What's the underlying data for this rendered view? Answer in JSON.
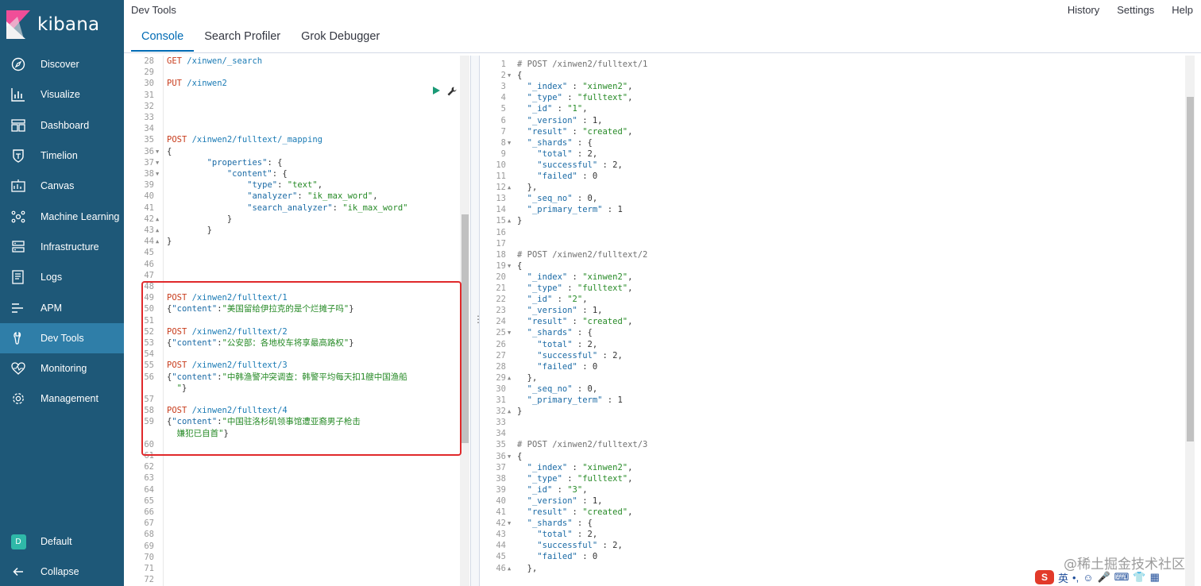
{
  "brand": {
    "name": "kibana"
  },
  "sidebar": {
    "items": [
      {
        "label": "Discover",
        "icon": "compass-icon"
      },
      {
        "label": "Visualize",
        "icon": "bar-chart-icon"
      },
      {
        "label": "Dashboard",
        "icon": "dashboard-icon"
      },
      {
        "label": "Timelion",
        "icon": "shield-icon"
      },
      {
        "label": "Canvas",
        "icon": "canvas-icon"
      },
      {
        "label": "Machine Learning",
        "icon": "machine-learning-icon"
      },
      {
        "label": "Infrastructure",
        "icon": "infrastructure-icon"
      },
      {
        "label": "Logs",
        "icon": "logs-icon"
      },
      {
        "label": "APM",
        "icon": "apm-icon"
      },
      {
        "label": "Dev Tools",
        "icon": "wrench-icon",
        "active": true
      },
      {
        "label": "Monitoring",
        "icon": "heartbeat-icon"
      },
      {
        "label": "Management",
        "icon": "gear-icon"
      }
    ],
    "space": {
      "label": "Default",
      "badge": "D"
    },
    "collapse_label": "Collapse"
  },
  "header": {
    "title": "Dev Tools",
    "links": [
      "History",
      "Settings",
      "Help"
    ],
    "tabs": [
      {
        "label": "Console",
        "active": true
      },
      {
        "label": "Search Profiler"
      },
      {
        "label": "Grok Debugger"
      }
    ]
  },
  "left_editor": {
    "lines": [
      {
        "n": "28",
        "segs": [
          [
            "m",
            "GET "
          ],
          [
            "u",
            "/xinwen/_search"
          ]
        ]
      },
      {
        "n": "29",
        "segs": []
      },
      {
        "n": "30",
        "segs": [
          [
            "m",
            "PUT "
          ],
          [
            "u",
            "/xinwen2"
          ]
        ]
      },
      {
        "n": "31",
        "segs": []
      },
      {
        "n": "32",
        "segs": []
      },
      {
        "n": "33",
        "segs": []
      },
      {
        "n": "34",
        "segs": []
      },
      {
        "n": "35",
        "segs": [
          [
            "m",
            "POST "
          ],
          [
            "u",
            "/xinwen2/fulltext/_mapping"
          ]
        ]
      },
      {
        "n": "36",
        "fold": "down",
        "segs": [
          [
            "p",
            "{"
          ]
        ]
      },
      {
        "n": "37",
        "fold": "down",
        "segs": [
          [
            "p",
            "        "
          ],
          [
            "k",
            "\"properties\""
          ],
          [
            "p",
            ": {"
          ]
        ]
      },
      {
        "n": "38",
        "fold": "down",
        "segs": [
          [
            "p",
            "            "
          ],
          [
            "k",
            "\"content\""
          ],
          [
            "p",
            ": {"
          ]
        ]
      },
      {
        "n": "39",
        "segs": [
          [
            "p",
            "                "
          ],
          [
            "k",
            "\"type\""
          ],
          [
            "p",
            ": "
          ],
          [
            "s",
            "\"text\""
          ],
          [
            "p",
            ","
          ]
        ]
      },
      {
        "n": "40",
        "segs": [
          [
            "p",
            "                "
          ],
          [
            "k",
            "\"analyzer\""
          ],
          [
            "p",
            ": "
          ],
          [
            "s",
            "\"ik_max_word\""
          ],
          [
            "p",
            ","
          ]
        ]
      },
      {
        "n": "41",
        "segs": [
          [
            "p",
            "                "
          ],
          [
            "k",
            "\"search_analyzer\""
          ],
          [
            "p",
            ": "
          ],
          [
            "s",
            "\"ik_max_word\""
          ]
        ]
      },
      {
        "n": "42",
        "fold": "up",
        "segs": [
          [
            "p",
            "            }"
          ]
        ]
      },
      {
        "n": "43",
        "fold": "up",
        "segs": [
          [
            "p",
            "        }"
          ]
        ]
      },
      {
        "n": "44",
        "fold": "up",
        "segs": [
          [
            "p",
            "}"
          ]
        ]
      },
      {
        "n": "45",
        "segs": []
      },
      {
        "n": "46",
        "segs": []
      },
      {
        "n": "47",
        "segs": []
      },
      {
        "n": "48",
        "segs": []
      },
      {
        "n": "49",
        "segs": [
          [
            "m",
            "POST "
          ],
          [
            "u",
            "/xinwen2/fulltext/1"
          ]
        ]
      },
      {
        "n": "50",
        "segs": [
          [
            "p",
            "{"
          ],
          [
            "k",
            "\"content\""
          ],
          [
            "p",
            ":"
          ],
          [
            "s",
            "\"美国留给伊拉克的是个烂摊子吗\""
          ],
          [
            "p",
            "}"
          ]
        ]
      },
      {
        "n": "51",
        "segs": []
      },
      {
        "n": "52",
        "segs": [
          [
            "m",
            "POST "
          ],
          [
            "u",
            "/xinwen2/fulltext/2"
          ]
        ]
      },
      {
        "n": "53",
        "segs": [
          [
            "p",
            "{"
          ],
          [
            "k",
            "\"content\""
          ],
          [
            "p",
            ":"
          ],
          [
            "s",
            "\"公安部：各地校车将享最高路权\""
          ],
          [
            "p",
            "}"
          ]
        ]
      },
      {
        "n": "54",
        "segs": []
      },
      {
        "n": "55",
        "segs": [
          [
            "m",
            "POST "
          ],
          [
            "u",
            "/xinwen2/fulltext/3"
          ]
        ]
      },
      {
        "n": "56",
        "segs": [
          [
            "p",
            "{"
          ],
          [
            "k",
            "\"content\""
          ],
          [
            "p",
            ":"
          ],
          [
            "s",
            "\"中韩渔警冲突调查：韩警平均每天扣1艘中国渔船"
          ]
        ]
      },
      {
        "n": "",
        "segs": [
          [
            "s",
            "  \""
          ],
          [
            "p",
            "}"
          ]
        ]
      },
      {
        "n": "57",
        "segs": []
      },
      {
        "n": "58",
        "segs": [
          [
            "m",
            "POST "
          ],
          [
            "u",
            "/xinwen2/fulltext/4"
          ]
        ]
      },
      {
        "n": "59",
        "segs": [
          [
            "p",
            "{"
          ],
          [
            "k",
            "\"content\""
          ],
          [
            "p",
            ":"
          ],
          [
            "s",
            "\"中国驻洛杉矶领事馆遭亚裔男子枪击"
          ]
        ]
      },
      {
        "n": "",
        "segs": [
          [
            "s",
            "  嫌犯已自首\""
          ],
          [
            "p",
            "}"
          ]
        ]
      },
      {
        "n": "60",
        "segs": []
      },
      {
        "n": "61",
        "segs": []
      },
      {
        "n": "62",
        "segs": []
      },
      {
        "n": "63",
        "segs": []
      },
      {
        "n": "64",
        "segs": []
      },
      {
        "n": "65",
        "segs": []
      },
      {
        "n": "66",
        "segs": []
      },
      {
        "n": "67",
        "segs": []
      },
      {
        "n": "68",
        "segs": []
      },
      {
        "n": "69",
        "segs": []
      },
      {
        "n": "70",
        "segs": []
      },
      {
        "n": "71",
        "segs": []
      },
      {
        "n": "72",
        "segs": []
      }
    ]
  },
  "right_editor": {
    "lines": [
      {
        "n": "1",
        "segs": [
          [
            "c",
            "# POST /xinwen2/fulltext/1"
          ]
        ]
      },
      {
        "n": "2",
        "fold": "down",
        "segs": [
          [
            "p",
            "{"
          ]
        ]
      },
      {
        "n": "3",
        "segs": [
          [
            "p",
            "  "
          ],
          [
            "k",
            "\"_index\""
          ],
          [
            "p",
            " : "
          ],
          [
            "s",
            "\"xinwen2\""
          ],
          [
            "p",
            ","
          ]
        ]
      },
      {
        "n": "4",
        "segs": [
          [
            "p",
            "  "
          ],
          [
            "k",
            "\"_type\""
          ],
          [
            "p",
            " : "
          ],
          [
            "s",
            "\"fulltext\""
          ],
          [
            "p",
            ","
          ]
        ]
      },
      {
        "n": "5",
        "segs": [
          [
            "p",
            "  "
          ],
          [
            "k",
            "\"_id\""
          ],
          [
            "p",
            " : "
          ],
          [
            "s",
            "\"1\""
          ],
          [
            "p",
            ","
          ]
        ]
      },
      {
        "n": "6",
        "segs": [
          [
            "p",
            "  "
          ],
          [
            "k",
            "\"_version\""
          ],
          [
            "p",
            " : 1,"
          ]
        ]
      },
      {
        "n": "7",
        "segs": [
          [
            "p",
            "  "
          ],
          [
            "k",
            "\"result\""
          ],
          [
            "p",
            " : "
          ],
          [
            "s",
            "\"created\""
          ],
          [
            "p",
            ","
          ]
        ]
      },
      {
        "n": "8",
        "fold": "down",
        "segs": [
          [
            "p",
            "  "
          ],
          [
            "k",
            "\"_shards\""
          ],
          [
            "p",
            " : {"
          ]
        ]
      },
      {
        "n": "9",
        "segs": [
          [
            "p",
            "    "
          ],
          [
            "k",
            "\"total\""
          ],
          [
            "p",
            " : 2,"
          ]
        ]
      },
      {
        "n": "10",
        "segs": [
          [
            "p",
            "    "
          ],
          [
            "k",
            "\"successful\""
          ],
          [
            "p",
            " : 2,"
          ]
        ]
      },
      {
        "n": "11",
        "segs": [
          [
            "p",
            "    "
          ],
          [
            "k",
            "\"failed\""
          ],
          [
            "p",
            " : 0"
          ]
        ]
      },
      {
        "n": "12",
        "fold": "up",
        "segs": [
          [
            "p",
            "  },"
          ]
        ]
      },
      {
        "n": "13",
        "segs": [
          [
            "p",
            "  "
          ],
          [
            "k",
            "\"_seq_no\""
          ],
          [
            "p",
            " : 0,"
          ]
        ]
      },
      {
        "n": "14",
        "segs": [
          [
            "p",
            "  "
          ],
          [
            "k",
            "\"_primary_term\""
          ],
          [
            "p",
            " : 1"
          ]
        ]
      },
      {
        "n": "15",
        "fold": "up",
        "segs": [
          [
            "p",
            "}"
          ]
        ]
      },
      {
        "n": "16",
        "segs": []
      },
      {
        "n": "17",
        "segs": []
      },
      {
        "n": "18",
        "segs": [
          [
            "c",
            "# POST /xinwen2/fulltext/2"
          ]
        ]
      },
      {
        "n": "19",
        "fold": "down",
        "segs": [
          [
            "p",
            "{"
          ]
        ]
      },
      {
        "n": "20",
        "segs": [
          [
            "p",
            "  "
          ],
          [
            "k",
            "\"_index\""
          ],
          [
            "p",
            " : "
          ],
          [
            "s",
            "\"xinwen2\""
          ],
          [
            "p",
            ","
          ]
        ]
      },
      {
        "n": "21",
        "segs": [
          [
            "p",
            "  "
          ],
          [
            "k",
            "\"_type\""
          ],
          [
            "p",
            " : "
          ],
          [
            "s",
            "\"fulltext\""
          ],
          [
            "p",
            ","
          ]
        ]
      },
      {
        "n": "22",
        "segs": [
          [
            "p",
            "  "
          ],
          [
            "k",
            "\"_id\""
          ],
          [
            "p",
            " : "
          ],
          [
            "s",
            "\"2\""
          ],
          [
            "p",
            ","
          ]
        ]
      },
      {
        "n": "23",
        "segs": [
          [
            "p",
            "  "
          ],
          [
            "k",
            "\"_version\""
          ],
          [
            "p",
            " : 1,"
          ]
        ]
      },
      {
        "n": "24",
        "segs": [
          [
            "p",
            "  "
          ],
          [
            "k",
            "\"result\""
          ],
          [
            "p",
            " : "
          ],
          [
            "s",
            "\"created\""
          ],
          [
            "p",
            ","
          ]
        ]
      },
      {
        "n": "25",
        "fold": "down",
        "segs": [
          [
            "p",
            "  "
          ],
          [
            "k",
            "\"_shards\""
          ],
          [
            "p",
            " : {"
          ]
        ]
      },
      {
        "n": "26",
        "segs": [
          [
            "p",
            "    "
          ],
          [
            "k",
            "\"total\""
          ],
          [
            "p",
            " : 2,"
          ]
        ]
      },
      {
        "n": "27",
        "segs": [
          [
            "p",
            "    "
          ],
          [
            "k",
            "\"successful\""
          ],
          [
            "p",
            " : 2,"
          ]
        ]
      },
      {
        "n": "28",
        "segs": [
          [
            "p",
            "    "
          ],
          [
            "k",
            "\"failed\""
          ],
          [
            "p",
            " : 0"
          ]
        ]
      },
      {
        "n": "29",
        "fold": "up",
        "segs": [
          [
            "p",
            "  },"
          ]
        ]
      },
      {
        "n": "30",
        "segs": [
          [
            "p",
            "  "
          ],
          [
            "k",
            "\"_seq_no\""
          ],
          [
            "p",
            " : 0,"
          ]
        ]
      },
      {
        "n": "31",
        "segs": [
          [
            "p",
            "  "
          ],
          [
            "k",
            "\"_primary_term\""
          ],
          [
            "p",
            " : 1"
          ]
        ]
      },
      {
        "n": "32",
        "fold": "up",
        "segs": [
          [
            "p",
            "}"
          ]
        ]
      },
      {
        "n": "33",
        "segs": []
      },
      {
        "n": "34",
        "segs": []
      },
      {
        "n": "35",
        "segs": [
          [
            "c",
            "# POST /xinwen2/fulltext/3"
          ]
        ]
      },
      {
        "n": "36",
        "fold": "down",
        "segs": [
          [
            "p",
            "{"
          ]
        ]
      },
      {
        "n": "37",
        "segs": [
          [
            "p",
            "  "
          ],
          [
            "k",
            "\"_index\""
          ],
          [
            "p",
            " : "
          ],
          [
            "s",
            "\"xinwen2\""
          ],
          [
            "p",
            ","
          ]
        ]
      },
      {
        "n": "38",
        "segs": [
          [
            "p",
            "  "
          ],
          [
            "k",
            "\"_type\""
          ],
          [
            "p",
            " : "
          ],
          [
            "s",
            "\"fulltext\""
          ],
          [
            "p",
            ","
          ]
        ]
      },
      {
        "n": "39",
        "segs": [
          [
            "p",
            "  "
          ],
          [
            "k",
            "\"_id\""
          ],
          [
            "p",
            " : "
          ],
          [
            "s",
            "\"3\""
          ],
          [
            "p",
            ","
          ]
        ]
      },
      {
        "n": "40",
        "segs": [
          [
            "p",
            "  "
          ],
          [
            "k",
            "\"_version\""
          ],
          [
            "p",
            " : 1,"
          ]
        ]
      },
      {
        "n": "41",
        "segs": [
          [
            "p",
            "  "
          ],
          [
            "k",
            "\"result\""
          ],
          [
            "p",
            " : "
          ],
          [
            "s",
            "\"created\""
          ],
          [
            "p",
            ","
          ]
        ]
      },
      {
        "n": "42",
        "fold": "down",
        "segs": [
          [
            "p",
            "  "
          ],
          [
            "k",
            "\"_shards\""
          ],
          [
            "p",
            " : {"
          ]
        ]
      },
      {
        "n": "43",
        "segs": [
          [
            "p",
            "    "
          ],
          [
            "k",
            "\"total\""
          ],
          [
            "p",
            " : 2,"
          ]
        ]
      },
      {
        "n": "44",
        "segs": [
          [
            "p",
            "    "
          ],
          [
            "k",
            "\"successful\""
          ],
          [
            "p",
            " : 2,"
          ]
        ]
      },
      {
        "n": "45",
        "segs": [
          [
            "p",
            "    "
          ],
          [
            "k",
            "\"failed\""
          ],
          [
            "p",
            " : 0"
          ]
        ]
      },
      {
        "n": "46",
        "fold": "up",
        "segs": [
          [
            "p",
            "  },"
          ]
        ]
      }
    ]
  },
  "watermark": "@稀土掘金技术社区",
  "ime": {
    "lang": "英",
    "logo": "S"
  }
}
